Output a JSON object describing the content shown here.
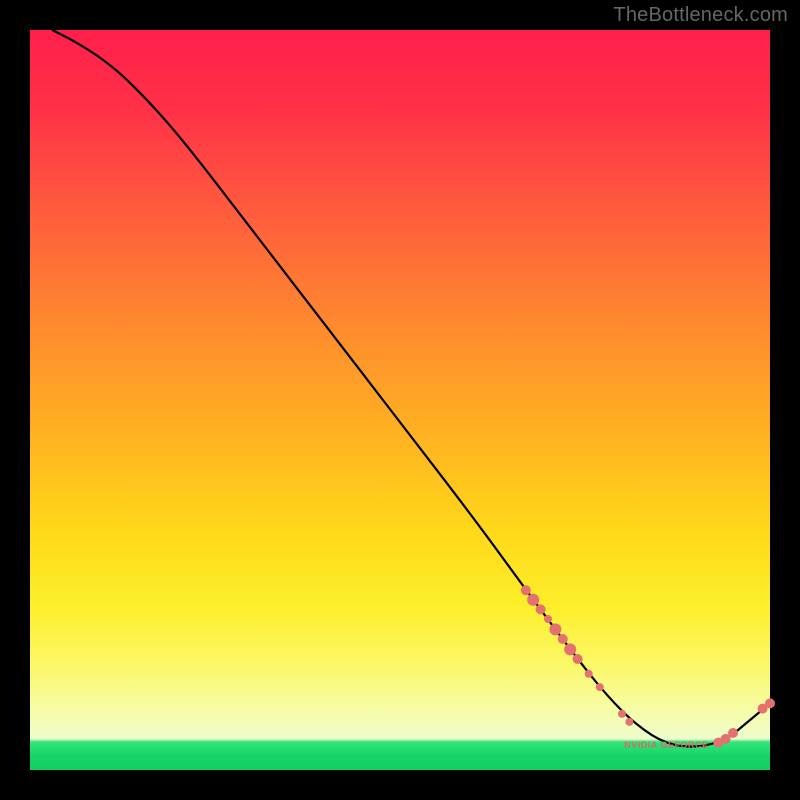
{
  "watermark": "TheBottleneck.com",
  "colors": {
    "page_bg": "#000000",
    "watermark": "#666666",
    "curve": "#000000",
    "marker": "#e2716f",
    "gradient_top": "#ff1f4b",
    "gradient_mid": "#ffd91a",
    "gradient_low": "#f6fca8",
    "gradient_bottom": "#18d568"
  },
  "chart_data": {
    "type": "line",
    "title": "",
    "xlabel": "",
    "ylabel": "",
    "xlim": [
      0,
      100
    ],
    "ylim": [
      0,
      100
    ],
    "grid": false,
    "legend": false,
    "series": [
      {
        "name": "curve",
        "x": [
          3,
          6,
          10,
          14,
          20,
          30,
          40,
          50,
          60,
          68,
          74,
          78,
          82,
          86,
          90,
          94,
          97,
          100
        ],
        "y": [
          100,
          98.5,
          96,
          92.5,
          86,
          73,
          60,
          47,
          34,
          23,
          15,
          10,
          6,
          3.5,
          3,
          4,
          6.5,
          9
        ]
      }
    ],
    "markers": [
      {
        "x": 67,
        "y": 24.3,
        "r": 5
      },
      {
        "x": 68,
        "y": 23.0,
        "r": 6
      },
      {
        "x": 69,
        "y": 21.7,
        "r": 5
      },
      {
        "x": 70,
        "y": 20.4,
        "r": 4
      },
      {
        "x": 71,
        "y": 19.0,
        "r": 6
      },
      {
        "x": 72,
        "y": 17.7,
        "r": 5
      },
      {
        "x": 73,
        "y": 16.3,
        "r": 6
      },
      {
        "x": 74,
        "y": 15.0,
        "r": 5
      },
      {
        "x": 75.5,
        "y": 13.0,
        "r": 4
      },
      {
        "x": 77,
        "y": 11.2,
        "r": 4
      },
      {
        "x": 80,
        "y": 7.6,
        "r": 4
      },
      {
        "x": 81,
        "y": 6.5,
        "r": 4
      },
      {
        "x": 93,
        "y": 3.7,
        "r": 5
      },
      {
        "x": 94,
        "y": 4.2,
        "r": 5
      },
      {
        "x": 95,
        "y": 5.0,
        "r": 5
      },
      {
        "x": 99,
        "y": 8.3,
        "r": 5
      },
      {
        "x": 100,
        "y": 9.0,
        "r": 5
      }
    ],
    "cluster_label": {
      "text": "NVIDIA GEFORCE",
      "x": 86,
      "y": 3
    }
  }
}
